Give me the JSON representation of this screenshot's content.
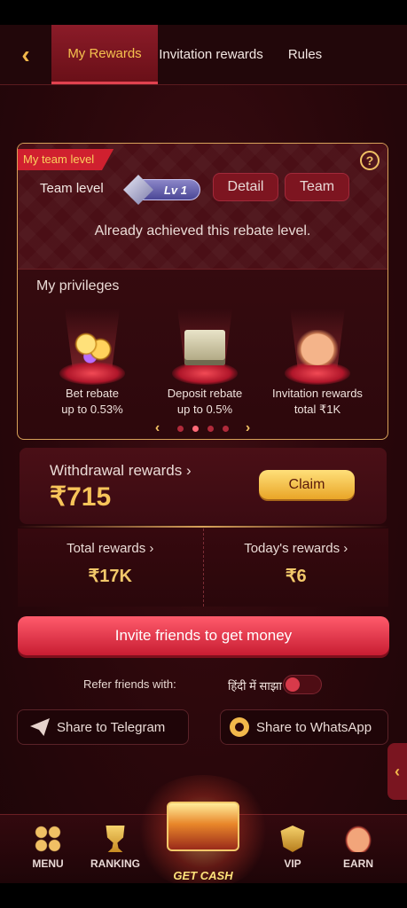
{
  "tabs": [
    {
      "label": "My Rewards",
      "active": true
    },
    {
      "label": "Invitation rewards",
      "active": false
    },
    {
      "label": "Rules",
      "active": false
    }
  ],
  "team": {
    "ribbon": "My team level",
    "level_label": "Team level",
    "level_badge": "Lv 1",
    "detail_button": "Detail",
    "team_button": "Team",
    "message": "Already achieved this rebate level."
  },
  "privileges": {
    "title": "My privileges",
    "items": [
      {
        "line1": "Bet rebate",
        "line2": "up to 0.53%",
        "icon": "coins-icon"
      },
      {
        "line1": "Deposit rebate",
        "line2": "up to 0.5%",
        "icon": "cash-box-icon"
      },
      {
        "line1": "Invitation rewards",
        "line2": "total ₹1K",
        "icon": "handshake-icon"
      }
    ],
    "page_count": 4,
    "current_page": 2
  },
  "withdrawal": {
    "title": "Withdrawal rewards ›",
    "amount": "₹715",
    "claim_button": "Claim"
  },
  "stats": {
    "total_label": "Total rewards ›",
    "total_value": "₹17K",
    "today_label": "Today's rewards ›",
    "today_value": "₹6"
  },
  "invite_button": "Invite friends to get money",
  "refer": {
    "label": "Refer friends with:",
    "language": "हिंदी में साझा करें",
    "toggle_on": false
  },
  "share": {
    "telegram": "Share to Telegram",
    "whatsapp": "Share to WhatsApp"
  },
  "nav": {
    "menu": "MENU",
    "ranking": "RANKING",
    "get_cash": "GET CASH",
    "vip": "VIP",
    "earn": "EARN"
  },
  "colors": {
    "accent_gold": "#f2c86a",
    "brand_red": "#c81d32",
    "background": "#2a070b"
  }
}
